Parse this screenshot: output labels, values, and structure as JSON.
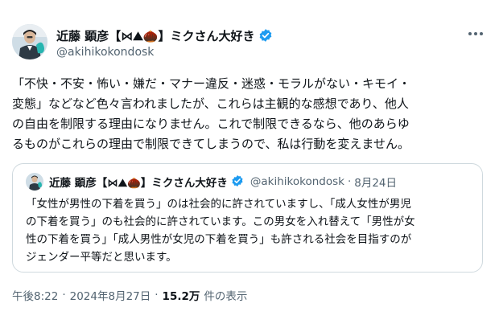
{
  "author": {
    "name": "近藤 顕彦【⋈⛰🌰】ミクさん大好き",
    "handle": "@akihikokondosk"
  },
  "tweet": {
    "lines": [
      "「不快・不安・怖い・嫌だ・マナー違反・迷惑・モラルがない・キモイ・",
      "変態」などなど色々言われましたが、これらは主観的な感想であり、他人",
      "の自由を制限する理由になりません。これで制限できるなら、他のあらゆ",
      "るものがこれらの理由で制限できてしまうので、私は行動を変えません。"
    ]
  },
  "quoted": {
    "name": "近藤 顕彦【⋈⛰🌰】ミクさん大好き",
    "handle": "@akihikokondosk",
    "separator": "·",
    "date": "8月24日",
    "lines": [
      "「女性が男性の下着を買う」のは社会的に許されていますし、「成人女性が男児",
      "の下着を買う」のも社会的に許されています。この男女を入れ替えて「男性が女",
      "性の下着を買う」「成人男性が女児の下着を買う」も許される社会を目指すのが",
      "ジェンダー平等だと思います。"
    ]
  },
  "meta": {
    "time": "午後8:22",
    "separator": "·",
    "date": "2024年8月27日",
    "views_count": "15.2万",
    "views_label": "件の表示"
  },
  "icons": {
    "verified": "verified-badge-icon",
    "more": "more-options-icon"
  },
  "colors": {
    "verified": "#1d9bf0",
    "text": "#0f1419",
    "secondary": "#536471",
    "border": "#cfd9de"
  }
}
